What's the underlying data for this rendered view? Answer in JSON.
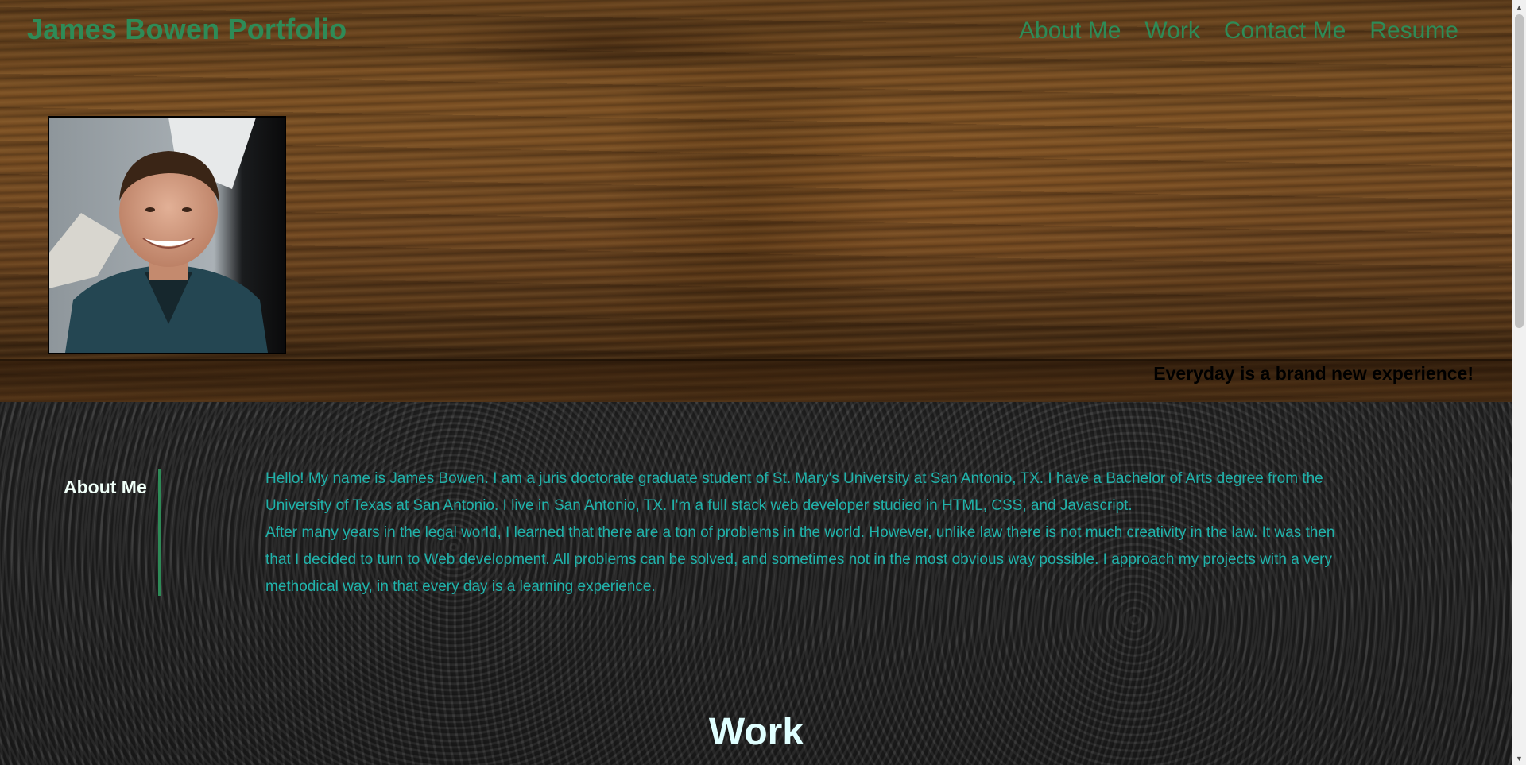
{
  "header": {
    "title": "James Bowen Portfolio",
    "nav": [
      {
        "label": "About Me"
      },
      {
        "label": "Work"
      },
      {
        "label": "Contact Me"
      },
      {
        "label": "Resume"
      }
    ]
  },
  "hero": {
    "portrait_alt": "James Bowen headshot",
    "tagline": "Everyday is a brand new experience!"
  },
  "about": {
    "heading": "About Me",
    "paragraph1": "Hello! My name is James Bowen. I am a juris doctorate graduate student of St. Mary's University at San Antonio, TX. I have a Bachelor of Arts degree from the University of Texas at San Antonio. I live in San Antonio, TX. I'm a full stack web developer studied in HTML, CSS, and Javascript.",
    "paragraph2": "After many years in the legal world, I learned that there are a ton of problems in the world. However, unlike law there is not much creativity in the law. It was then that I decided to turn to Web development. All problems can be solved, and sometimes not in the most obvious way possible. I approach my projects with a very methodical way, in that every day is a learning experience."
  },
  "work": {
    "heading": "Work"
  },
  "colors": {
    "accent_green": "#2e8b57",
    "text_teal": "#20b2aa",
    "heading_light": "#e0ffff"
  }
}
